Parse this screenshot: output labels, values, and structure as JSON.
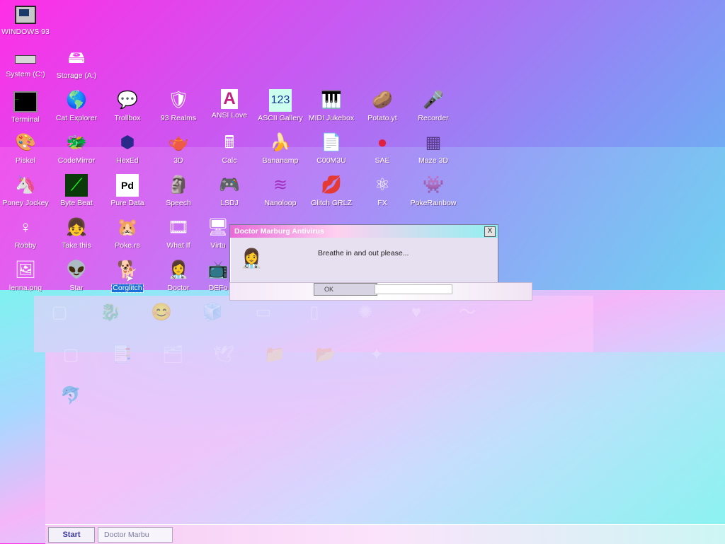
{
  "desktop": {
    "icons": [
      {
        "label": "WINDOWS 93",
        "icon": "computer-icon"
      },
      {
        "label": "System (C:)",
        "icon": "drive-icon"
      },
      {
        "label": "Storage (A:)",
        "icon": "floppy-drive-icon"
      },
      {
        "label": "Terminal",
        "icon": "terminal-icon"
      },
      {
        "label": "Cat Explorer",
        "icon": "globe-icon"
      },
      {
        "label": "Trollbox",
        "icon": "chat-icon"
      },
      {
        "label": "93 Realms",
        "icon": "knight-icon"
      },
      {
        "label": "ANSI Love",
        "icon": "letter-a-icon"
      },
      {
        "label": "ASCII Gallery",
        "icon": "numbers-icon"
      },
      {
        "label": "MIDI Jukebox",
        "icon": "piano-icon"
      },
      {
        "label": "Potato.yt",
        "icon": "potato-icon"
      },
      {
        "label": "Recorder",
        "icon": "microphone-icon"
      },
      {
        "label": "Piskel",
        "icon": "palette-icon"
      },
      {
        "label": "CodeMirror",
        "icon": "code-icon"
      },
      {
        "label": "HexEd",
        "icon": "cube-icon"
      },
      {
        "label": "3D",
        "icon": "teapot-icon"
      },
      {
        "label": "Calc",
        "icon": "calculator-icon"
      },
      {
        "label": "Bananamp",
        "icon": "banana-icon"
      },
      {
        "label": "C00M3U",
        "icon": "playlist-icon"
      },
      {
        "label": "SAE",
        "icon": "ball-icon"
      },
      {
        "label": "Maze 3D",
        "icon": "maze-icon"
      },
      {
        "label": "Poney Jockey",
        "icon": "pony-icon"
      },
      {
        "label": "Byte Beat",
        "icon": "waveform-icon"
      },
      {
        "label": "Pure Data",
        "icon": "pd-icon"
      },
      {
        "label": "Speech",
        "icon": "face-icon"
      },
      {
        "label": "LSDJ",
        "icon": "gameboy-icon"
      },
      {
        "label": "Nanoloop",
        "icon": "nanoloop-icon"
      },
      {
        "label": "Glitch GRLZ",
        "icon": "lips-icon"
      },
      {
        "label": "FX",
        "icon": "atom-icon"
      },
      {
        "label": "PokeRainbow",
        "icon": "characters-icon"
      },
      {
        "label": "Robby",
        "icon": "stickman-icon"
      },
      {
        "label": "Take this",
        "icon": "pixel-girl-icon"
      },
      {
        "label": "Poke.rs",
        "icon": "creature-icon"
      },
      {
        "label": "What If",
        "icon": "film-icon"
      },
      {
        "label": "Virtu",
        "icon": "virtual-icon"
      },
      {
        "label": "lenna.png",
        "icon": "image-icon"
      },
      {
        "label": "Star",
        "icon": "yoda-icon"
      },
      {
        "label": "Corglitch",
        "icon": "corgi-icon"
      },
      {
        "label": "Doctor",
        "icon": "doctor-icon"
      },
      {
        "label": "DEFo",
        "icon": "defo-icon"
      }
    ]
  },
  "dialog": {
    "title": "Doctor Marburg Antivirus",
    "message": "Breathe in and out please...",
    "ok_label": "OK",
    "close_glyph": "X"
  },
  "taskbar": {
    "start_label": "Start",
    "task_label": "Doctor Marbu"
  }
}
